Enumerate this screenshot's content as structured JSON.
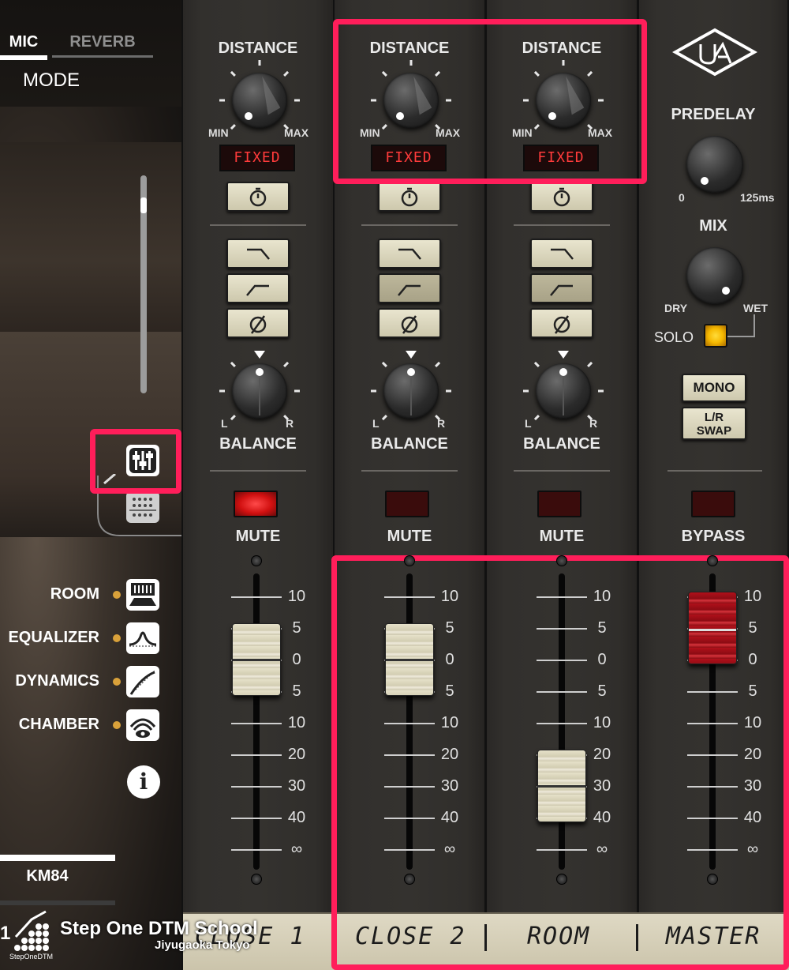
{
  "left_panel": {
    "tabs": [
      {
        "label": "MIC",
        "active": true
      },
      {
        "label": "REVERB",
        "active": false
      }
    ],
    "mode_label": "MODE",
    "nav_items": [
      {
        "label": "ROOM",
        "icon": "room-icon"
      },
      {
        "label": "EQUALIZER",
        "icon": "eq-icon"
      },
      {
        "label": "DYNAMICS",
        "icon": "dynamics-icon"
      },
      {
        "label": "CHAMBER",
        "icon": "chamber-icon"
      }
    ],
    "info_label": "i",
    "mic_name": "KM84",
    "channel_number": "1"
  },
  "channels": [
    {
      "distance_label": "DISTANCE",
      "min": "MIN",
      "max": "MAX",
      "distance_display": "FIXED",
      "balance_label": "BALANCE",
      "bal_l": "L",
      "bal_r": "R",
      "mute_label": "MUTE",
      "mute_on": true,
      "fader_db": 0,
      "tape_name": "CLOSE 1"
    },
    {
      "distance_label": "DISTANCE",
      "min": "MIN",
      "max": "MAX",
      "distance_display": "FIXED",
      "balance_label": "BALANCE",
      "bal_l": "L",
      "bal_r": "R",
      "mute_label": "MUTE",
      "mute_on": false,
      "fader_db": 0,
      "tape_name": "CLOSE 2"
    },
    {
      "distance_label": "DISTANCE",
      "min": "MIN",
      "max": "MAX",
      "distance_display": "FIXED",
      "balance_label": "BALANCE",
      "bal_l": "L",
      "bal_r": "R",
      "mute_label": "MUTE",
      "mute_on": false,
      "fader_db": -30,
      "tape_name": "ROOM"
    }
  ],
  "fader_scale": [
    "10",
    "5",
    "0",
    "5",
    "10",
    "20",
    "30",
    "40",
    "∞"
  ],
  "master": {
    "predelay_label": "PREDELAY",
    "predelay_min": "0",
    "predelay_max": "125ms",
    "mix_label": "MIX",
    "mix_dry": "DRY",
    "mix_wet": "WET",
    "solo_label": "SOLO",
    "mono_label": "MONO",
    "lr_swap_label": "L/R SWAP",
    "bypass_label": "BYPASS",
    "fader_db": 5,
    "tape_name": "MASTER"
  },
  "watermark": {
    "title": "Step One DTM School",
    "subtitle": "Jiyugaoka Tokyo",
    "small": "StepOneDTM"
  },
  "colors": {
    "highlight": "#ff1e5a",
    "mute_on": "#ff2a2a",
    "solo_lamp": "#f5b800",
    "lcd_text": "#ff3b3b",
    "tape": "#d9d3bc"
  }
}
